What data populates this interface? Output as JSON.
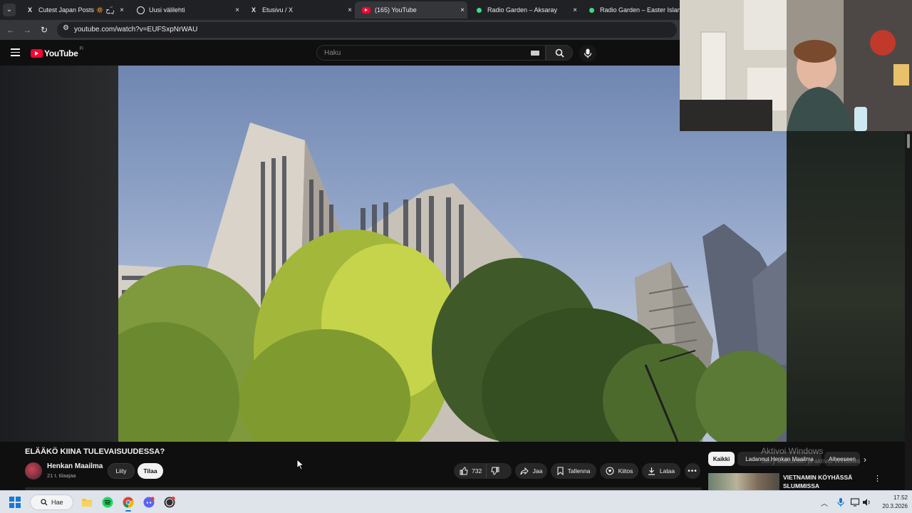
{
  "browser": {
    "tabs": [
      {
        "title": "Cutest Japan Posts 🔅 ͏رٍ̯ ۜحِ",
        "favicon": "x-logo-icon"
      },
      {
        "title": "Uusi välilehti",
        "favicon": "globe-icon"
      },
      {
        "title": "Etusivu / X",
        "favicon": "x-logo-icon"
      },
      {
        "title": "(165) YouTube",
        "favicon": "youtube-icon"
      },
      {
        "title": "Radio Garden – Aksaray",
        "favicon": "radio-dot-icon"
      },
      {
        "title": "Radio Garden – Easter Island",
        "favicon": "radio-dot-icon"
      }
    ],
    "close_glyph": "×",
    "url": "youtube.com/watch?v=EUFSxpNrWAU"
  },
  "youtube": {
    "logo_text": "YouTube",
    "region": "FI",
    "search_placeholder": "Haku",
    "video_title": "ELÄÄKÖ KIINA TULEVAISUUDESSA?",
    "channel_name": "Henkan Maailma",
    "channel_subs": "21 t. tilaajaa",
    "join_label": "Liity",
    "subscribe_label": "Tilaa",
    "like_count": "732",
    "share_label": "Jaa",
    "save_label": "Tallenna",
    "thanks_label": "Kiitos",
    "download_label": "Lataa",
    "more_glyph": "•••",
    "chips": [
      "Kaikki",
      "Ladannut Henkan Maailma",
      "Aiheeseen"
    ],
    "recommendation": {
      "title_line1": "VIETNAMIN KÖYHÄSSÄ",
      "title_line2": "SLUMMISSA"
    }
  },
  "watermark": {
    "line1": "Aktivoi Windows",
    "line2": "Siirry asetuksiin ja aktivoi Windows"
  },
  "taskbar": {
    "search_label": "Hae",
    "time": "17.52",
    "date": "20.3.2026",
    "apps": [
      "file-explorer-icon",
      "spotify-icon",
      "chrome-icon",
      "discord-icon",
      "obs-icon"
    ]
  },
  "colors": {
    "yt_red": "#ff0033",
    "accent_blue": "#1878d6",
    "spotify_green": "#1ed760",
    "discord_blurple": "#5865f2"
  }
}
